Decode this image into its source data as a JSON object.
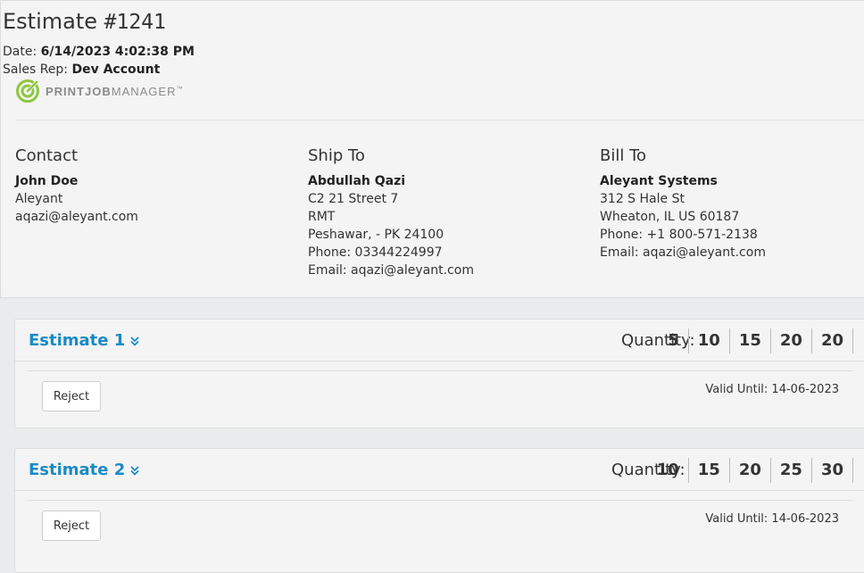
{
  "estimate": {
    "title_prefix": "Estimate ",
    "title_number": "#1241",
    "date_label": "Date:",
    "date_value": "6/14/2023 4:02:38 PM",
    "rep_label": "Sales Rep:",
    "rep_value": "Dev Account"
  },
  "logo": {
    "brand_bold": "PRINTJOB",
    "brand_light": "MANAGER",
    "tm": "™",
    "color": "#8cc63f"
  },
  "contact": {
    "heading": "Contact",
    "name": "John Doe",
    "lines": [
      "Aleyant",
      "aqazi@aleyant.com"
    ]
  },
  "ship_to": {
    "heading": "Ship To",
    "name": "Abdullah Qazi",
    "lines": [
      "C2 21 Street 7",
      "RMT",
      "Peshawar, - PK 24100",
      "Phone: 03344224997",
      "Email: aqazi@aleyant.com"
    ]
  },
  "bill_to": {
    "heading": "Bill To",
    "name": "Aleyant Systems",
    "lines": [
      "312 S Hale St",
      "Wheaton, IL US 60187",
      "Phone: +1 800-571-2138",
      "Email: aqazi@aleyant.com"
    ]
  },
  "estimates": [
    {
      "title": "Estimate 1",
      "quantity_label": "Quantity:",
      "quantities": [
        "5",
        "10",
        "15",
        "20",
        "20"
      ],
      "reject_label": "Reject",
      "valid_until": "Valid Until: 14-06-2023"
    },
    {
      "title": "Estimate 2",
      "quantity_label": "Quantity:",
      "quantities": [
        "10",
        "15",
        "20",
        "25",
        "30"
      ],
      "reject_label": "Reject",
      "valid_until": "Valid Until: 14-06-2023"
    }
  ],
  "colors": {
    "accent": "#1a8ac6",
    "logo_green": "#8cc63f"
  }
}
